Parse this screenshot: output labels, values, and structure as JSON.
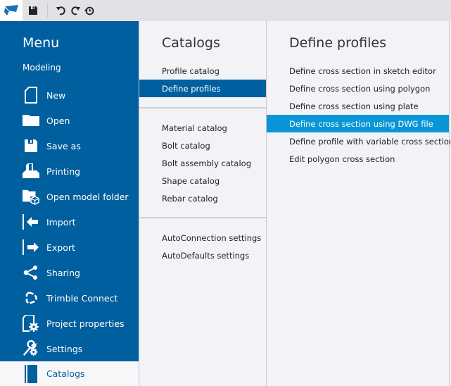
{
  "toolbar": {
    "logo_icon": "tekla-logo-icon",
    "buttons": [
      {
        "name": "save",
        "icon": "save-icon"
      },
      {
        "name": "undo",
        "icon": "undo-icon"
      },
      {
        "name": "redo",
        "icon": "redo-icon"
      },
      {
        "name": "history",
        "icon": "history-icon"
      }
    ]
  },
  "sidebar": {
    "title": "Menu",
    "subtitle": "Modeling",
    "accent_color": "#005f9e",
    "items": [
      {
        "label": "New",
        "icon": "new-file-icon"
      },
      {
        "label": "Open",
        "icon": "folder-icon"
      },
      {
        "label": "Save as",
        "icon": "save-icon"
      },
      {
        "label": "Printing",
        "icon": "printer-icon"
      },
      {
        "label": "Open model folder",
        "icon": "model-folder-icon"
      },
      {
        "label": "Import",
        "icon": "import-icon"
      },
      {
        "label": "Export",
        "icon": "export-icon"
      },
      {
        "label": "Sharing",
        "icon": "share-icon"
      },
      {
        "label": "Trimble Connect",
        "icon": "trimble-connect-icon"
      },
      {
        "label": "Project properties",
        "icon": "project-properties-icon"
      },
      {
        "label": "Settings",
        "icon": "settings-icon"
      },
      {
        "label": "Catalogs",
        "icon": "catalog-book-icon",
        "selected": true
      }
    ]
  },
  "catalogs": {
    "title": "Catalogs",
    "groups": [
      [
        {
          "label": "Profile catalog"
        },
        {
          "label": "Define profiles",
          "selected": true
        }
      ],
      [
        {
          "label": "Material catalog"
        },
        {
          "label": "Bolt catalog"
        },
        {
          "label": "Bolt assembly catalog"
        },
        {
          "label": "Shape catalog"
        },
        {
          "label": "Rebar catalog"
        }
      ],
      [
        {
          "label": "AutoConnection settings"
        },
        {
          "label": "AutoDefaults settings"
        }
      ]
    ]
  },
  "define_profiles": {
    "title": "Define profiles",
    "items": [
      {
        "label": "Define cross section in sketch editor"
      },
      {
        "label": "Define cross section using polygon"
      },
      {
        "label": "Define cross section using plate"
      },
      {
        "label": "Define cross section using DWG file",
        "hovered": true
      },
      {
        "label": "Define profile with variable cross section"
      },
      {
        "label": "Edit polygon cross section"
      }
    ],
    "highlight_color": "#0a96d6"
  }
}
